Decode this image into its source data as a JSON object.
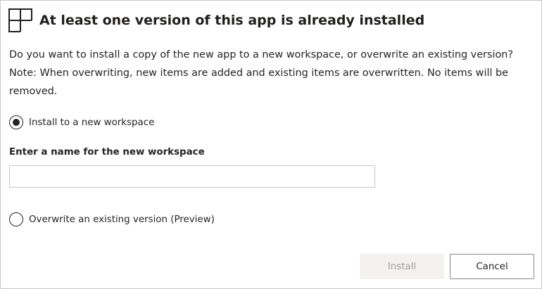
{
  "dialog": {
    "title": "At least one version of this app is already installed",
    "header_icon": "workspace-icon",
    "description_line1": "Do you want to install a copy of the new app to a new workspace, or overwrite an existing version?",
    "description_line2": "Note: When overwriting, new items are added and existing items are overwritten. No items will be removed."
  },
  "options": {
    "new_workspace_label": "Install to a new workspace",
    "new_workspace_selected": true,
    "overwrite_label": "Overwrite an existing version (Preview)",
    "overwrite_selected": false
  },
  "workspace_name": {
    "label": "Enter a name for the new workspace",
    "value": "",
    "placeholder": ""
  },
  "buttons": {
    "install_label": "Install",
    "install_disabled": true,
    "cancel_label": "Cancel"
  },
  "colors": {
    "text": "#252423",
    "border": "#c8c8c8",
    "disabled_bg": "#f3f2f1",
    "disabled_text": "#a19f9d"
  }
}
